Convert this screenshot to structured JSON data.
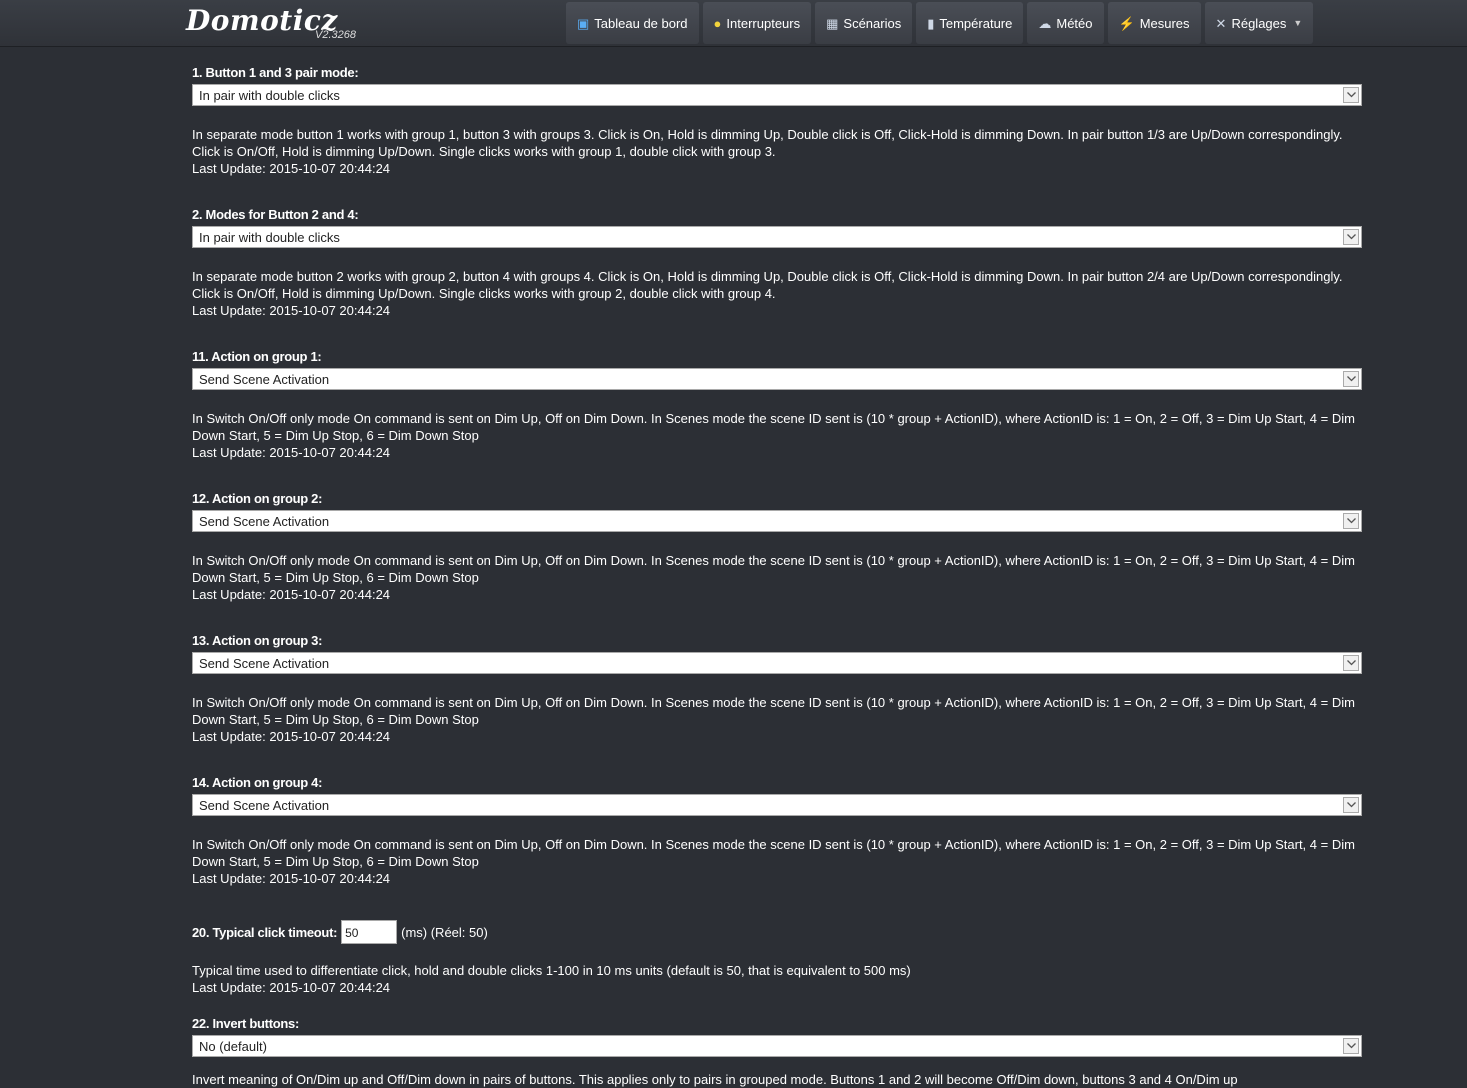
{
  "app": {
    "logo": "Domoticz",
    "version": "V2.3268"
  },
  "nav": {
    "tabs": [
      {
        "label": "Tableau de bord",
        "icon": "dashboard-icon"
      },
      {
        "label": "Interrupteurs",
        "icon": "lightbulb-icon"
      },
      {
        "label": "Scénarios",
        "icon": "clapperboard-icon"
      },
      {
        "label": "Température",
        "icon": "thermometer-icon"
      },
      {
        "label": "Météo",
        "icon": "weather-icon"
      },
      {
        "label": "Mesures",
        "icon": "lightning-icon"
      },
      {
        "label": "Réglages",
        "icon": "tools-icon",
        "dropdown": true
      }
    ]
  },
  "params": [
    {
      "label": "1. Button 1 and 3 pair mode:",
      "value": "In pair with double clicks",
      "desc": "In separate mode button 1 works with group 1, button 3 with groups 3. Click is On, Hold is dimming Up, Double click is Off, Click-Hold is dimming Down. In pair button 1/3 are Up/Down correspondingly. Click is On/Off, Hold is dimming Up/Down. Single clicks works with group 1, double click with group 3.",
      "last_update": "Last Update: 2015-10-07 20:44:24"
    },
    {
      "label": "2. Modes for Button 2 and 4:",
      "value": "In pair with double clicks",
      "desc": "In separate mode button 2 works with group 2, button 4 with groups 4. Click is On, Hold is dimming Up, Double click is Off, Click-Hold is dimming Down. In pair button 2/4 are Up/Down correspondingly. Click is On/Off, Hold is dimming Up/Down. Single clicks works with group 2, double click with group 4.",
      "last_update": "Last Update: 2015-10-07 20:44:24"
    },
    {
      "label": "11. Action on group 1:",
      "value": "Send Scene Activation",
      "desc": "In Switch On/Off only mode On command is sent on Dim Up, Off on Dim Down. In Scenes mode the scene ID sent is (10 * group + ActionID), where ActionID is: 1 = On, 2 = Off, 3 = Dim Up Start, 4 = Dim Down Start, 5 = Dim Up Stop, 6 = Dim Down Stop",
      "last_update": "Last Update: 2015-10-07 20:44:24"
    },
    {
      "label": "12. Action on group 2:",
      "value": "Send Scene Activation",
      "desc": "In Switch On/Off only mode On command is sent on Dim Up, Off on Dim Down. In Scenes mode the scene ID sent is (10 * group + ActionID), where ActionID is: 1 = On, 2 = Off, 3 = Dim Up Start, 4 = Dim Down Start, 5 = Dim Up Stop, 6 = Dim Down Stop",
      "last_update": "Last Update: 2015-10-07 20:44:24"
    },
    {
      "label": "13. Action on group 3:",
      "value": "Send Scene Activation",
      "desc": "In Switch On/Off only mode On command is sent on Dim Up, Off on Dim Down. In Scenes mode the scene ID sent is (10 * group + ActionID), where ActionID is: 1 = On, 2 = Off, 3 = Dim Up Start, 4 = Dim Down Start, 5 = Dim Up Stop, 6 = Dim Down Stop",
      "last_update": "Last Update: 2015-10-07 20:44:24"
    },
    {
      "label": "14. Action on group 4:",
      "value": "Send Scene Activation",
      "desc": "In Switch On/Off only mode On command is sent on Dim Up, Off on Dim Down. In Scenes mode the scene ID sent is (10 * group + ActionID), where ActionID is: 1 = On, 2 = Off, 3 = Dim Up Start, 4 = Dim Down Start, 5 = Dim Up Stop, 6 = Dim Down Stop",
      "last_update": "Last Update: 2015-10-07 20:44:24"
    }
  ],
  "timeout": {
    "label": "20. Typical click timeout:",
    "value": "50",
    "unit": "(ms) (Réel: 50)",
    "desc": "Typical time used to differentiate click, hold and double clicks 1-100 in 10 ms units (default is 50, that is equivalent to 500 ms)",
    "last_update": "Last Update: 2015-10-07 20:44:24"
  },
  "invert": {
    "label": "22. Invert buttons:",
    "value": "No (default)",
    "desc": "Invert meaning of On/Dim up and Off/Dim down in pairs of buttons. This applies only to pairs in grouped mode. Buttons 1 and 2 will become Off/Dim down, buttons 3 and 4 On/Dim up"
  }
}
